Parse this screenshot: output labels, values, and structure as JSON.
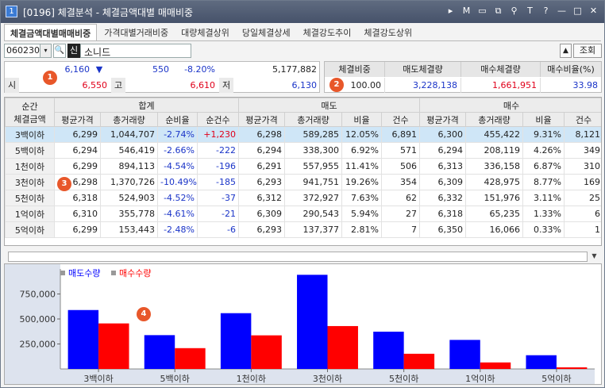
{
  "window": {
    "number": "1",
    "title": "[0196] 체결분석 - 체결금액대별 매매비중",
    "icons": [
      "play-icon",
      "m-icon",
      "window-icon",
      "copy-icon",
      "pin-icon",
      "font-icon",
      "help-icon",
      "minimize-icon",
      "maximize-icon",
      "close-icon"
    ],
    "icon_glyphs": [
      "▸",
      "M",
      "▭",
      "⧉",
      "⚲",
      "T",
      "?",
      "—",
      "□",
      "✕"
    ]
  },
  "tabs": [
    "체결금액대별매매비중",
    "가격대별거래비중",
    "대량체결상위",
    "당일체결상세",
    "체결강도추이",
    "체결강도상위"
  ],
  "controls": {
    "code": "060230",
    "dropdown_glyph": "▾",
    "search_glyph": "🔍",
    "sin_label": "신",
    "stock_name": "소니드",
    "up_button": "▲",
    "lookup_button": "조회"
  },
  "quote": {
    "price": "6,160",
    "change_arrow": "▼",
    "change": "550",
    "change_rate": "-8.20%",
    "volume": "5,177,882",
    "open_label": "시",
    "open": "6,550",
    "high_label": "고",
    "high": "6,610",
    "low_label": "저",
    "low": "6,130"
  },
  "ratio": {
    "headers": [
      "체결비중",
      "매도체결량",
      "매수체결량",
      "매수비율(%)"
    ],
    "values": [
      "100.00",
      "3,228,138",
      "1,661,951",
      "33.98"
    ]
  },
  "grid": {
    "group_headers": [
      "순간\n체결금액",
      "합계",
      "매도",
      "매수"
    ],
    "first_header_line1": "순간",
    "first_header_line2": "체결금액",
    "sub_headers": [
      "평균가격",
      "총거래량",
      "순비율",
      "순건수",
      "평균가격",
      "총거래량",
      "비율",
      "건수",
      "평균가격",
      "총거래량",
      "비율",
      "건수"
    ],
    "rows": [
      {
        "label": "3백이하",
        "cells": [
          "6,299",
          "1,044,707",
          "-2.74%",
          "+1,230",
          "6,298",
          "589,285",
          "12.05%",
          "6,891",
          "6,300",
          "455,422",
          "9.31%",
          "8,121"
        ]
      },
      {
        "label": "5백이하",
        "cells": [
          "6,294",
          "546,419",
          "-2.66%",
          "-222",
          "6,294",
          "338,300",
          "6.92%",
          "571",
          "6,294",
          "208,119",
          "4.26%",
          "349"
        ]
      },
      {
        "label": "1천이하",
        "cells": [
          "6,299",
          "894,113",
          "-4.54%",
          "-196",
          "6,291",
          "557,955",
          "11.41%",
          "506",
          "6,313",
          "336,158",
          "6.87%",
          "310"
        ]
      },
      {
        "label": "3천이하",
        "cells": [
          "6,298",
          "1,370,726",
          "-10.49%",
          "-185",
          "6,293",
          "941,751",
          "19.26%",
          "354",
          "6,309",
          "428,975",
          "8.77%",
          "169"
        ]
      },
      {
        "label": "5천이하",
        "cells": [
          "6,318",
          "524,903",
          "-4.52%",
          "-37",
          "6,312",
          "372,927",
          "7.63%",
          "62",
          "6,332",
          "151,976",
          "3.11%",
          "25"
        ]
      },
      {
        "label": "1억이하",
        "cells": [
          "6,310",
          "355,778",
          "-4.61%",
          "-21",
          "6,309",
          "290,543",
          "5.94%",
          "27",
          "6,318",
          "65,235",
          "1.33%",
          "6"
        ]
      },
      {
        "label": "5억이하",
        "cells": [
          "6,299",
          "153,443",
          "-2.48%",
          "-6",
          "6,293",
          "137,377",
          "2.81%",
          "7",
          "6,350",
          "16,066",
          "0.33%",
          "1"
        ]
      }
    ]
  },
  "badges": [
    "1",
    "2",
    "3",
    "4"
  ],
  "colors": {
    "sell": "#0000ff",
    "buy": "#ff0000",
    "blue_text": "#1a34c8",
    "red_text": "#e0001a",
    "selected_row": "#cfe6f7"
  },
  "chart_data": {
    "type": "bar",
    "categories": [
      "3백이하",
      "5백이하",
      "1천이하",
      "3천이하",
      "5천이하",
      "1억이하",
      "5억이하"
    ],
    "series": [
      {
        "name": "매도수량",
        "values": [
          589285,
          338300,
          557955,
          941751,
          372927,
          290543,
          137377
        ]
      },
      {
        "name": "매수수량",
        "values": [
          455422,
          208119,
          336158,
          428975,
          151976,
          65235,
          16066
        ]
      }
    ],
    "yticks": [
      "250,000",
      "500,000",
      "750,000"
    ],
    "ytick_values": [
      250000,
      500000,
      750000
    ],
    "ylim": [
      0,
      1000000
    ],
    "legend": "top-left",
    "grid": false
  }
}
